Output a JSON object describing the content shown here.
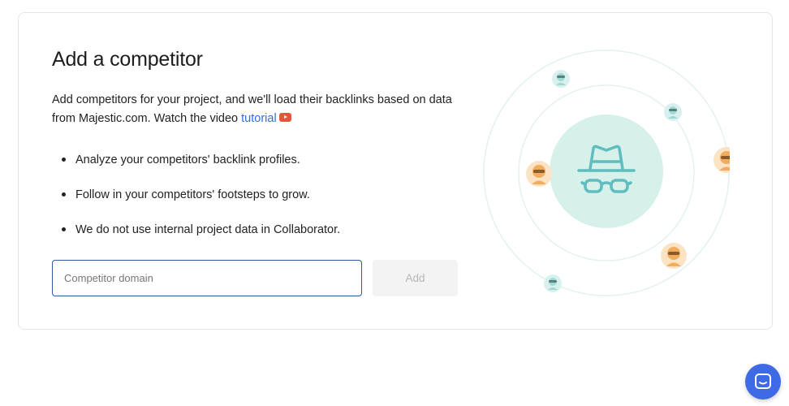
{
  "card": {
    "title": "Add a competitor",
    "description_text": "Add competitors for your project, and we'll load their backlinks based on data from Majestic.com. Watch the video ",
    "tutorial_link": "tutorial",
    "bullets": [
      "Analyze your competitors' backlink profiles.",
      "Follow in your competitors' footsteps to grow.",
      "We do not use internal project data in Collaborator."
    ],
    "domain_input": {
      "placeholder": "Competitor domain",
      "value": ""
    },
    "add_button": "Add"
  },
  "illustration": {
    "center_icon": "incognito-spy-icon",
    "colors": {
      "center_circle": "#d6f0ea",
      "spy_stroke": "#5fbcbf",
      "orbit": "#e3f1ef",
      "avatar_orange": "#f1ad5e",
      "avatar_teal": "#9fd9d2"
    }
  },
  "chat_widget": {
    "icon": "chat-bubble-icon",
    "color": "#3f6ae5"
  }
}
